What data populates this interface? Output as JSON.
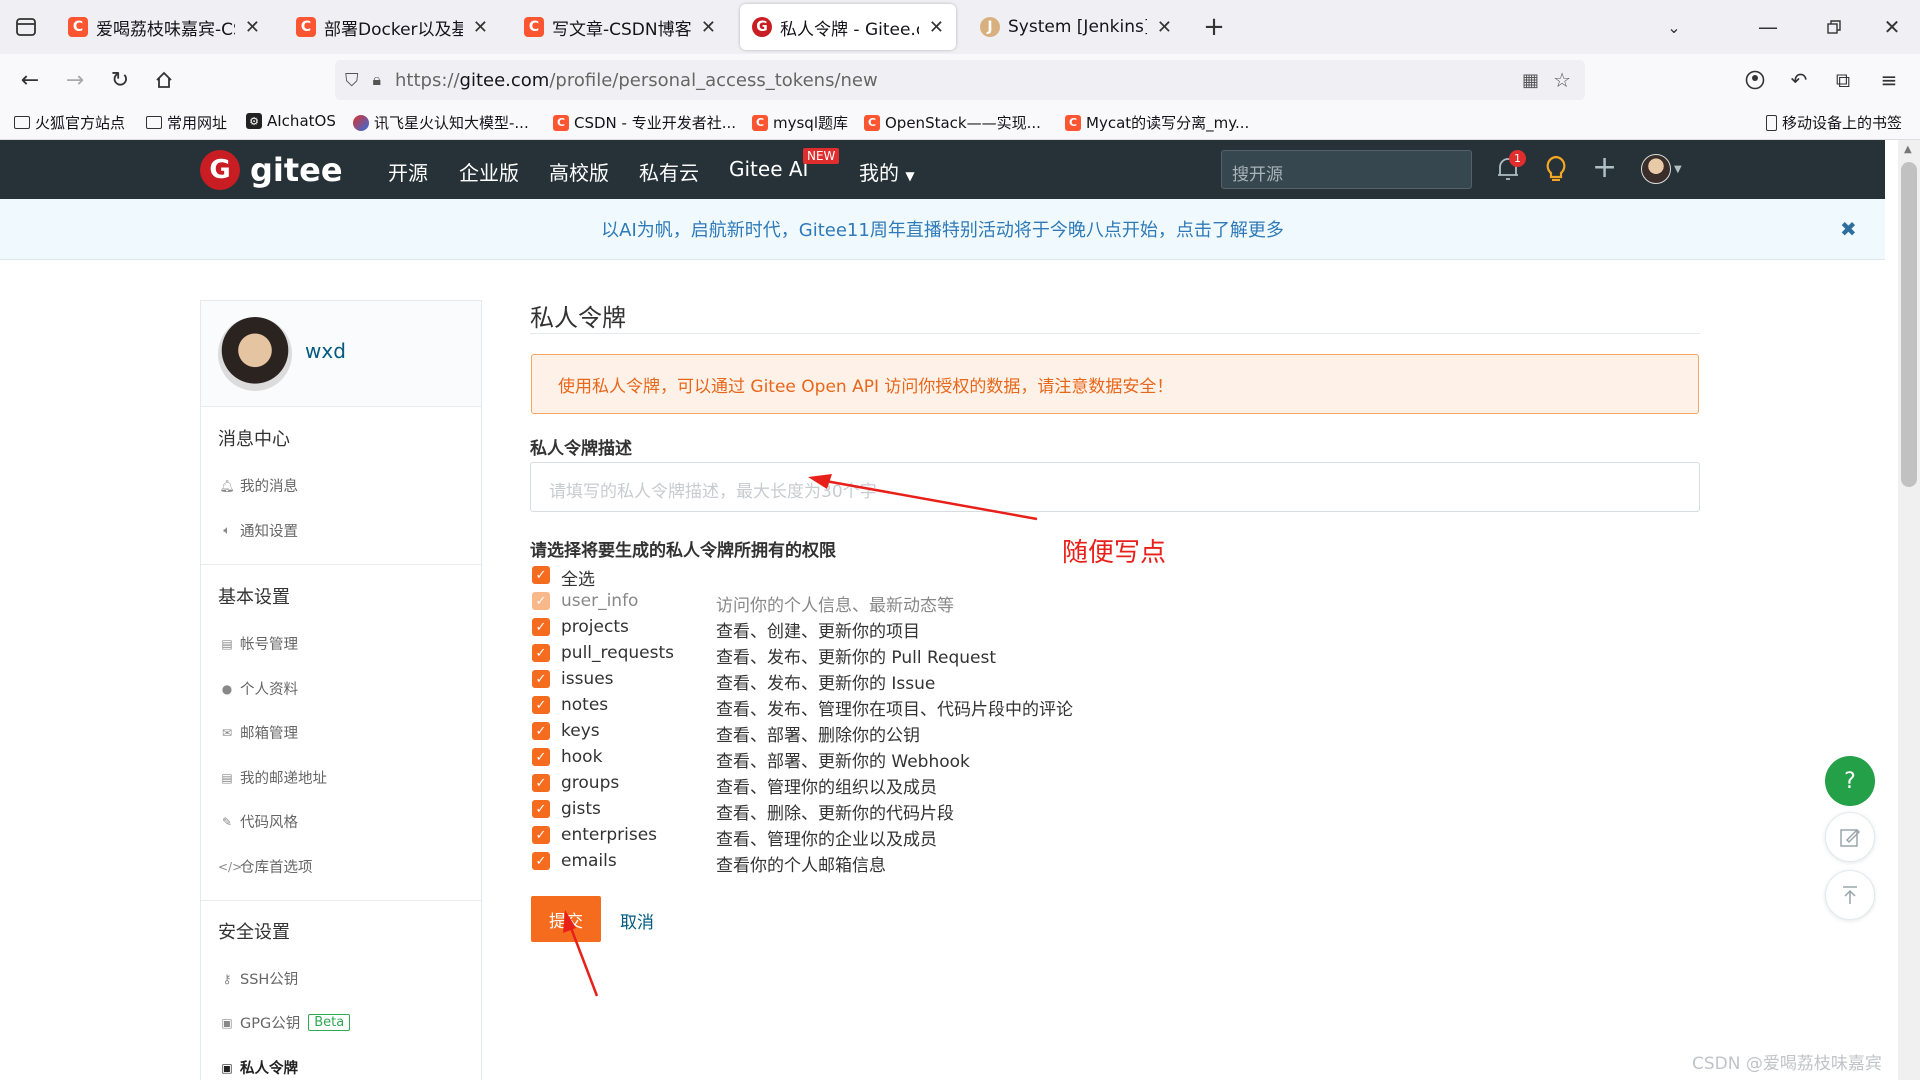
{
  "browser": {
    "tabs": [
      {
        "title": "爱喝荔枝味嘉宾-CSDN博客",
        "icon": "C"
      },
      {
        "title": "部署Docker以及基础命令-CSDN",
        "icon": "C"
      },
      {
        "title": "写文章-CSDN博客",
        "icon": "C"
      },
      {
        "title": "私人令牌 - Gitee.com",
        "icon": "G"
      },
      {
        "title": "System [Jenkins]",
        "icon": "J"
      }
    ],
    "url_prefix": "https://",
    "url_host": "gitee.com",
    "url_path": "/profile/personal_access_tokens/new",
    "bookmarks": [
      "火狐官方站点",
      "常用网址",
      "AIchatOS",
      "讯飞星火认知大模型-...",
      "CSDN - 专业开发者社...",
      "mysql题库",
      "OpenStack——实现...",
      "Mycat的读写分离_my..."
    ],
    "mobile_bookmarks": "移动设备上的书签"
  },
  "gitee": {
    "logo": "gitee",
    "logo_mark": "G",
    "nav": [
      "开源",
      "企业版",
      "高校版",
      "私有云",
      "Gitee AI",
      "我的"
    ],
    "new_badge": "NEW",
    "search_placeholder": "搜开源",
    "notif_count": "1",
    "banner": "以AI为帆，启航新时代，Gitee11周年直播特别活动将于今晚八点开始，点击了解更多",
    "banner_close": "✖"
  },
  "sidebar": {
    "username": "wxd",
    "sections": [
      {
        "title": "消息中心",
        "items": [
          "我的消息",
          "通知设置"
        ]
      },
      {
        "title": "基本设置",
        "items": [
          "帐号管理",
          "个人资料",
          "邮箱管理",
          "我的邮递地址",
          "代码风格",
          "仓库首选项"
        ]
      },
      {
        "title": "安全设置",
        "items": [
          "SSH公钥",
          "GPG公钥",
          "私人令牌"
        ]
      }
    ],
    "beta_badge": "Beta"
  },
  "main": {
    "page_title": "私人令牌",
    "warning": "使用私人令牌，可以通过 Gitee Open API 访问你授权的数据，请注意数据安全！",
    "desc_label": "私人令牌描述",
    "desc_placeholder": "请填写的私人令牌描述，最大长度为30个字",
    "perm_label": "请选择将要生成的私人令牌所拥有的权限",
    "select_all": "全选",
    "permissions": [
      {
        "name": "user_info",
        "desc": "访问你的个人信息、最新动态等"
      },
      {
        "name": "projects",
        "desc": "查看、创建、更新你的项目"
      },
      {
        "name": "pull_requests",
        "desc": "查看、发布、更新你的 Pull Request"
      },
      {
        "name": "issues",
        "desc": "查看、发布、更新你的 Issue"
      },
      {
        "name": "notes",
        "desc": "查看、发布、管理你在项目、代码片段中的评论"
      },
      {
        "name": "keys",
        "desc": "查看、部署、删除你的公钥"
      },
      {
        "name": "hook",
        "desc": "查看、部署、更新你的 Webhook"
      },
      {
        "name": "groups",
        "desc": "查看、管理你的组织以及成员"
      },
      {
        "name": "gists",
        "desc": "查看、删除、更新你的代码片段"
      },
      {
        "name": "enterprises",
        "desc": "查看、管理你的企业以及成员"
      },
      {
        "name": "emails",
        "desc": "查看你的个人邮箱信息"
      }
    ],
    "submit": "提交",
    "cancel": "取消"
  },
  "annotation": {
    "text": "随便写点",
    "color": "#e8201a"
  },
  "float": {
    "help": "?"
  },
  "watermark": "CSDN @爱喝荔枝味嘉宾",
  "colors": {
    "accent": "#f56c1f",
    "header": "#263238",
    "link": "#005980",
    "help": "#24a148"
  }
}
